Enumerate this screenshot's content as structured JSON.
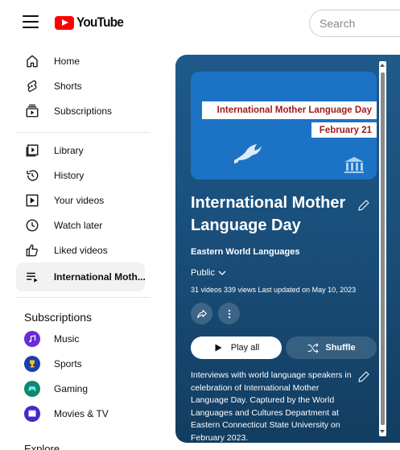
{
  "header": {
    "logo_text": "YouTube",
    "search_placeholder": "Search"
  },
  "sidebar": {
    "main_items": [
      {
        "label": "Home",
        "icon": "home-icon"
      },
      {
        "label": "Shorts",
        "icon": "shorts-icon"
      },
      {
        "label": "Subscriptions",
        "icon": "subscriptions-icon"
      }
    ],
    "library_items": [
      {
        "label": "Library",
        "icon": "library-icon"
      },
      {
        "label": "History",
        "icon": "history-icon"
      },
      {
        "label": "Your videos",
        "icon": "your-videos-icon"
      },
      {
        "label": "Watch later",
        "icon": "watch-later-icon"
      },
      {
        "label": "Liked videos",
        "icon": "liked-videos-icon"
      },
      {
        "label": "International Moth...",
        "icon": "playlist-icon",
        "active": true
      }
    ],
    "subscriptions_title": "Subscriptions",
    "subscriptions": [
      {
        "label": "Music",
        "icon": "music-icon",
        "color": "#6a2bd8"
      },
      {
        "label": "Sports",
        "icon": "sports-icon",
        "color": "#1c3fa8"
      },
      {
        "label": "Gaming",
        "icon": "gaming-icon",
        "color": "#0d8a6a"
      },
      {
        "label": "Movies & TV",
        "icon": "movies-tv-icon",
        "color": "#3d2bd0"
      }
    ],
    "explore_title": "Explore"
  },
  "playlist": {
    "thumbnail_line1": "International Mother Language Day",
    "thumbnail_line2": "February 21",
    "title": "International Mother Language Day",
    "channel": "Eastern World Languages",
    "privacy": "Public",
    "stats": "31 videos  339 views  Last updated on May 10, 2023",
    "play_all_label": "Play all",
    "shuffle_label": "Shuffle",
    "description": "Interviews with world language speakers in celebration of International Mother Language Day.  Captured by the World Languages and Cultures Department at Eastern Connecticut State University on February 2023.",
    "bg_color": "#1a4f7b",
    "thumb_color": "#1c73c5",
    "accent_text_color": "#9b1b1b"
  }
}
